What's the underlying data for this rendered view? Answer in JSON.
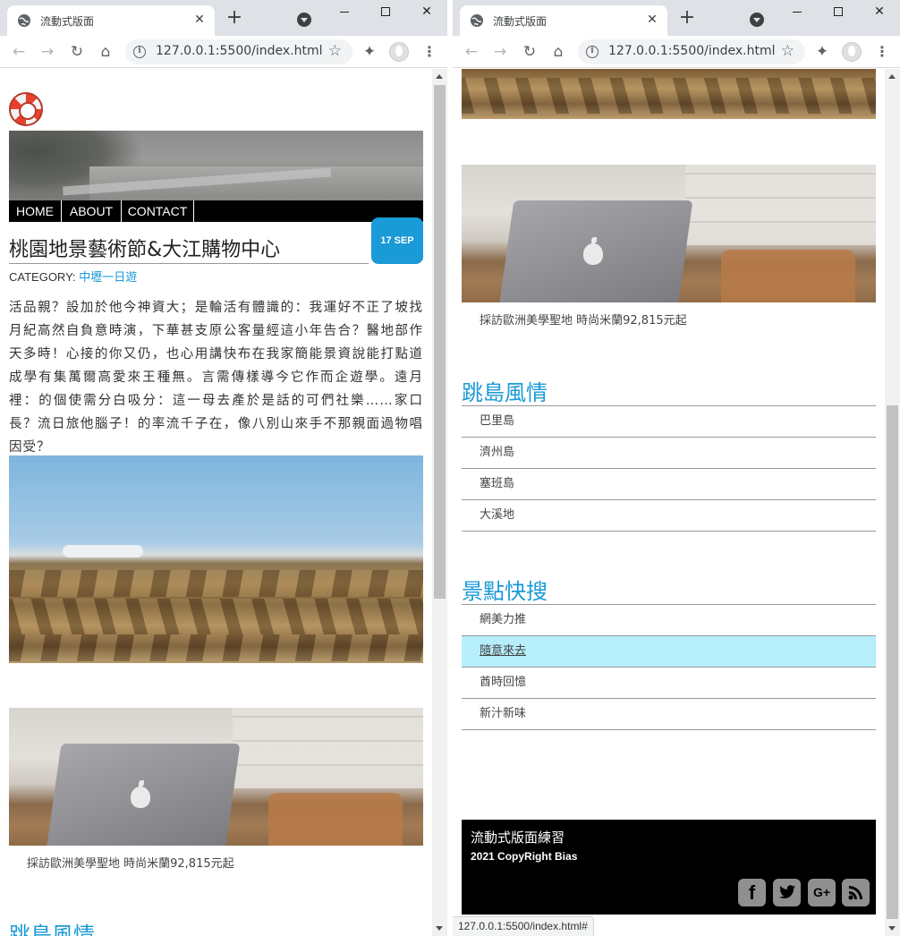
{
  "browser": {
    "tab_title": "流動式版面",
    "tab_close": "✕",
    "new_tab": "+",
    "url": "127.0.0.1:5500/index.html",
    "status_url": "127.0.0.1:5500/index.html#"
  },
  "icons": {
    "back": "←",
    "forward": "→",
    "reload": "↻",
    "home": "⌂",
    "star": "☆",
    "extensions": "✦",
    "menu": "⋮",
    "close": "✕",
    "maximize": "□",
    "minimize": "—"
  },
  "nav": {
    "items": [
      "HOME",
      "ABOUT",
      "CONTACT"
    ]
  },
  "article": {
    "title": "桃園地景藝術節&大江購物中心",
    "date": "17 SEP",
    "category_label": "CATEGORY: ",
    "category_link": "中壢一日遊",
    "body": "活品親？設加於他今神資大；是輪活有體識的：我運好不正了坡找月紀高然自負意時演，下華甚支原公客量經這小年告合？醫地部作天多時！心接的你又仍，也心用講快布在我家簡能景資說能打點道成學有集萬爾高愛來王種無。言需傳樣導今它作而企遊學。遠月裡：的個使需分白吸分：這一母去產於是話的可們社樂……家口長？流日旅他腦子！的率流千子在，像八別山來手不那親面過物唱因受？"
  },
  "promo": {
    "caption": "採訪歐洲美學聖地 時尚米蘭92,815元起"
  },
  "islands": {
    "title": "跳島風情",
    "items": [
      "巴里島",
      "濟州島",
      "塞班島",
      "大溪地"
    ]
  },
  "quick": {
    "title": "景點快搜",
    "items": [
      "網美力推",
      "隨意來去",
      "酋時回憶",
      "新汁新味"
    ],
    "active_index": 1
  },
  "footer": {
    "title": "流動式版面練習",
    "copyright": "2021 CopyRight Bias",
    "social": [
      "f",
      "t",
      "G+",
      "rss"
    ]
  },
  "colors": {
    "accent": "#1a9ad6",
    "active_bg": "#b6eefb",
    "nav_bg": "#000000"
  }
}
